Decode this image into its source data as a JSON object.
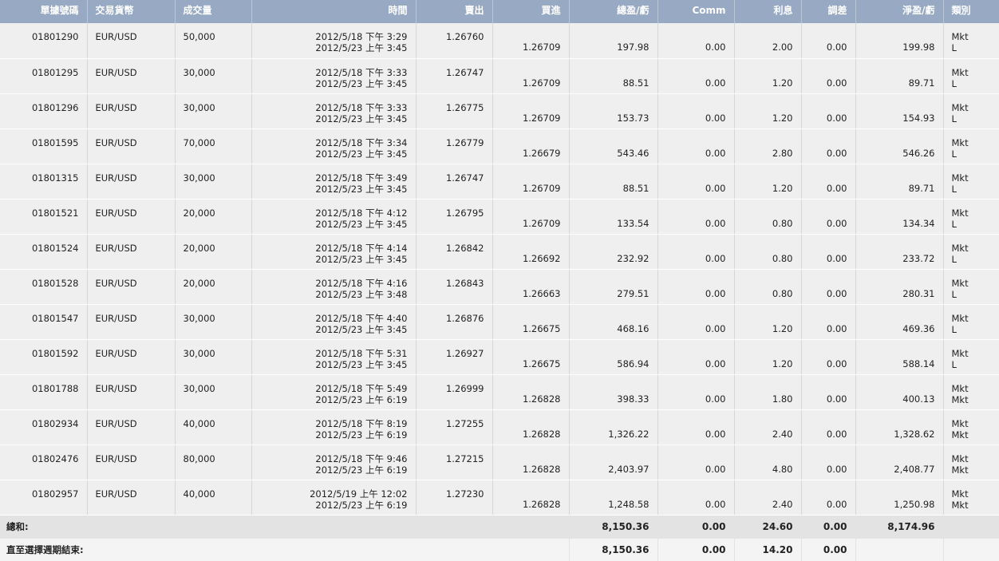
{
  "headers": {
    "order_no": "單據號碼",
    "currency_pair": "交易貨幣",
    "volume": "成交量",
    "time": "時間",
    "sell": "賣出",
    "buy": "買進",
    "gross_pl": "總盈/虧",
    "comm": "Comm",
    "interest": "利息",
    "adjustment": "調差",
    "net_pl": "淨盈/虧",
    "type": "類別"
  },
  "rows": [
    {
      "order": "01801290",
      "pair": "EUR/USD",
      "volume": "50,000",
      "time_open": "2012/5/18 下午 3:29",
      "time_close": "2012/5/23 上午 3:45",
      "sell": "1.26760",
      "buy": "1.26709",
      "gross": "197.98",
      "comm": "0.00",
      "interest": "2.00",
      "adjust": "0.00",
      "net": "199.98",
      "type1": "Mkt",
      "type2": "L"
    },
    {
      "order": "01801295",
      "pair": "EUR/USD",
      "volume": "30,000",
      "time_open": "2012/5/18 下午 3:33",
      "time_close": "2012/5/23 上午 3:45",
      "sell": "1.26747",
      "buy": "1.26709",
      "gross": "88.51",
      "comm": "0.00",
      "interest": "1.20",
      "adjust": "0.00",
      "net": "89.71",
      "type1": "Mkt",
      "type2": "L"
    },
    {
      "order": "01801296",
      "pair": "EUR/USD",
      "volume": "30,000",
      "time_open": "2012/5/18 下午 3:33",
      "time_close": "2012/5/23 上午 3:45",
      "sell": "1.26775",
      "buy": "1.26709",
      "gross": "153.73",
      "comm": "0.00",
      "interest": "1.20",
      "adjust": "0.00",
      "net": "154.93",
      "type1": "Mkt",
      "type2": "L"
    },
    {
      "order": "01801595",
      "pair": "EUR/USD",
      "volume": "70,000",
      "time_open": "2012/5/18 下午 3:34",
      "time_close": "2012/5/23 上午 3:45",
      "sell": "1.26779",
      "buy": "1.26679",
      "gross": "543.46",
      "comm": "0.00",
      "interest": "2.80",
      "adjust": "0.00",
      "net": "546.26",
      "type1": "Mkt",
      "type2": "L"
    },
    {
      "order": "01801315",
      "pair": "EUR/USD",
      "volume": "30,000",
      "time_open": "2012/5/18 下午 3:49",
      "time_close": "2012/5/23 上午 3:45",
      "sell": "1.26747",
      "buy": "1.26709",
      "gross": "88.51",
      "comm": "0.00",
      "interest": "1.20",
      "adjust": "0.00",
      "net": "89.71",
      "type1": "Mkt",
      "type2": "L"
    },
    {
      "order": "01801521",
      "pair": "EUR/USD",
      "volume": "20,000",
      "time_open": "2012/5/18 下午 4:12",
      "time_close": "2012/5/23 上午 3:45",
      "sell": "1.26795",
      "buy": "1.26709",
      "gross": "133.54",
      "comm": "0.00",
      "interest": "0.80",
      "adjust": "0.00",
      "net": "134.34",
      "type1": "Mkt",
      "type2": "L"
    },
    {
      "order": "01801524",
      "pair": "EUR/USD",
      "volume": "20,000",
      "time_open": "2012/5/18 下午 4:14",
      "time_close": "2012/5/23 上午 3:45",
      "sell": "1.26842",
      "buy": "1.26692",
      "gross": "232.92",
      "comm": "0.00",
      "interest": "0.80",
      "adjust": "0.00",
      "net": "233.72",
      "type1": "Mkt",
      "type2": "L"
    },
    {
      "order": "01801528",
      "pair": "EUR/USD",
      "volume": "20,000",
      "time_open": "2012/5/18 下午 4:16",
      "time_close": "2012/5/23 上午 3:48",
      "sell": "1.26843",
      "buy": "1.26663",
      "gross": "279.51",
      "comm": "0.00",
      "interest": "0.80",
      "adjust": "0.00",
      "net": "280.31",
      "type1": "Mkt",
      "type2": "L"
    },
    {
      "order": "01801547",
      "pair": "EUR/USD",
      "volume": "30,000",
      "time_open": "2012/5/18 下午 4:40",
      "time_close": "2012/5/23 上午 3:45",
      "sell": "1.26876",
      "buy": "1.26675",
      "gross": "468.16",
      "comm": "0.00",
      "interest": "1.20",
      "adjust": "0.00",
      "net": "469.36",
      "type1": "Mkt",
      "type2": "L"
    },
    {
      "order": "01801592",
      "pair": "EUR/USD",
      "volume": "30,000",
      "time_open": "2012/5/18 下午 5:31",
      "time_close": "2012/5/23 上午 3:45",
      "sell": "1.26927",
      "buy": "1.26675",
      "gross": "586.94",
      "comm": "0.00",
      "interest": "1.20",
      "adjust": "0.00",
      "net": "588.14",
      "type1": "Mkt",
      "type2": "L"
    },
    {
      "order": "01801788",
      "pair": "EUR/USD",
      "volume": "30,000",
      "time_open": "2012/5/18 下午 5:49",
      "time_close": "2012/5/23 上午 6:19",
      "sell": "1.26999",
      "buy": "1.26828",
      "gross": "398.33",
      "comm": "0.00",
      "interest": "1.80",
      "adjust": "0.00",
      "net": "400.13",
      "type1": "Mkt",
      "type2": "Mkt"
    },
    {
      "order": "01802934",
      "pair": "EUR/USD",
      "volume": "40,000",
      "time_open": "2012/5/18 下午 8:19",
      "time_close": "2012/5/23 上午 6:19",
      "sell": "1.27255",
      "buy": "1.26828",
      "gross": "1,326.22",
      "comm": "0.00",
      "interest": "2.40",
      "adjust": "0.00",
      "net": "1,328.62",
      "type1": "Mkt",
      "type2": "Mkt"
    },
    {
      "order": "01802476",
      "pair": "EUR/USD",
      "volume": "80,000",
      "time_open": "2012/5/18 下午 9:46",
      "time_close": "2012/5/23 上午 6:19",
      "sell": "1.27215",
      "buy": "1.26828",
      "gross": "2,403.97",
      "comm": "0.00",
      "interest": "4.80",
      "adjust": "0.00",
      "net": "2,408.77",
      "type1": "Mkt",
      "type2": "Mkt"
    },
    {
      "order": "01802957",
      "pair": "EUR/USD",
      "volume": "40,000",
      "time_open": "2012/5/19 上午 12:02",
      "time_close": "2012/5/23 上午 6:19",
      "sell": "1.27230",
      "buy": "1.26828",
      "gross": "1,248.58",
      "comm": "0.00",
      "interest": "2.40",
      "adjust": "0.00",
      "net": "1,250.98",
      "type1": "Mkt",
      "type2": "Mkt"
    }
  ],
  "total": {
    "label": "總和:",
    "gross": "8,150.36",
    "comm": "0.00",
    "interest": "24.60",
    "adjust": "0.00",
    "net": "8,174.96"
  },
  "period_end": {
    "label": "直至選擇週期結束:",
    "gross": "8,150.36",
    "comm": "0.00",
    "interest": "14.20",
    "adjust": "0.00"
  }
}
